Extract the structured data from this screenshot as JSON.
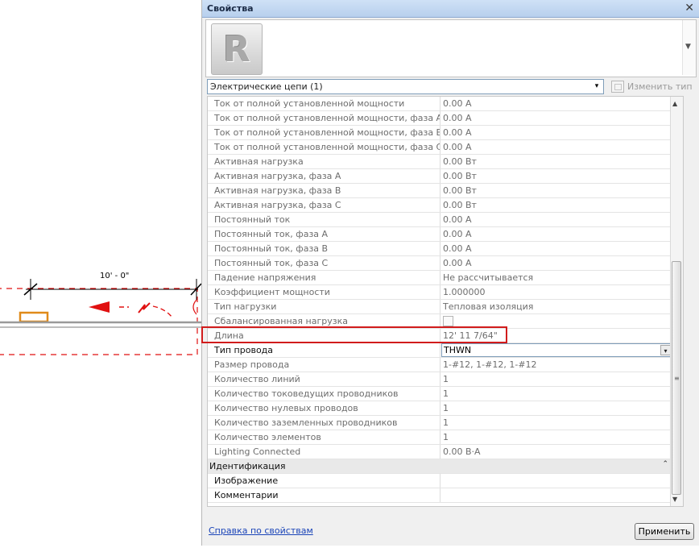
{
  "canvas": {
    "dimension_label": "10' - 0\"",
    "accent_color": "#e01010",
    "element_color": "#e08a1a"
  },
  "panel": {
    "title": "Свойства",
    "close_icon": "✕",
    "type_preview_logo": "R",
    "selector_value": "Электрические цепи (1)",
    "edit_type_label": "Изменить тип"
  },
  "properties": {
    "rows": [
      {
        "label": "Ток от полной установленной мощности",
        "value": "0.00 A"
      },
      {
        "label": "Ток от полной установленной мощности, фаза A",
        "value": "0.00 A"
      },
      {
        "label": "Ток от полной установленной мощности, фаза B",
        "value": "0.00 A"
      },
      {
        "label": "Ток от полной установленной мощности, фаза C",
        "value": "0.00 A"
      },
      {
        "label": "Активная нагрузка",
        "value": "0.00 Вт"
      },
      {
        "label": "Активная нагрузка, фаза A",
        "value": "0.00 Вт"
      },
      {
        "label": "Активная нагрузка, фаза B",
        "value": "0.00 Вт"
      },
      {
        "label": "Активная нагрузка, фаза C",
        "value": "0.00 Вт"
      },
      {
        "label": "Постоянный ток",
        "value": "0.00 A"
      },
      {
        "label": "Постоянный ток, фаза A",
        "value": "0.00 A"
      },
      {
        "label": "Постоянный ток, фаза B",
        "value": "0.00 A"
      },
      {
        "label": "Постоянный ток, фаза C",
        "value": "0.00 A"
      },
      {
        "label": "Падение напряжения",
        "value": "Не рассчитывается"
      },
      {
        "label": "Коэффициент мощности",
        "value": "1.000000"
      },
      {
        "label": "Тип нагрузки",
        "value": "Тепловая изоляция"
      },
      {
        "label": "Сбалансированная нагрузка",
        "value": ""
      },
      {
        "label": "Длина",
        "value": "12'  11 7/64\""
      },
      {
        "label": "Тип провода",
        "value": "THWN"
      },
      {
        "label": "Размер провода",
        "value": "1-#12, 1-#12, 1-#12"
      },
      {
        "label": "Количество линий",
        "value": "1"
      },
      {
        "label": "Количество токоведущих проводников",
        "value": "1"
      },
      {
        "label": "Количество нулевых проводов",
        "value": "1"
      },
      {
        "label": "Количество заземленных проводников",
        "value": "1"
      },
      {
        "label": "Количество элементов",
        "value": "1"
      },
      {
        "label": "Lighting Connected",
        "value": "0.00 B·A"
      }
    ],
    "group_identification": "Идентификация",
    "image_label": "Изображение",
    "comments_label": "Комментарии"
  },
  "footer": {
    "help_link": "Справка по свойствам",
    "apply_button": "Применить"
  },
  "icons": {
    "dropdown": "▾",
    "collapse": "⌃",
    "scroll_up": "▲",
    "scroll_down": "▼",
    "grip": "≡"
  }
}
